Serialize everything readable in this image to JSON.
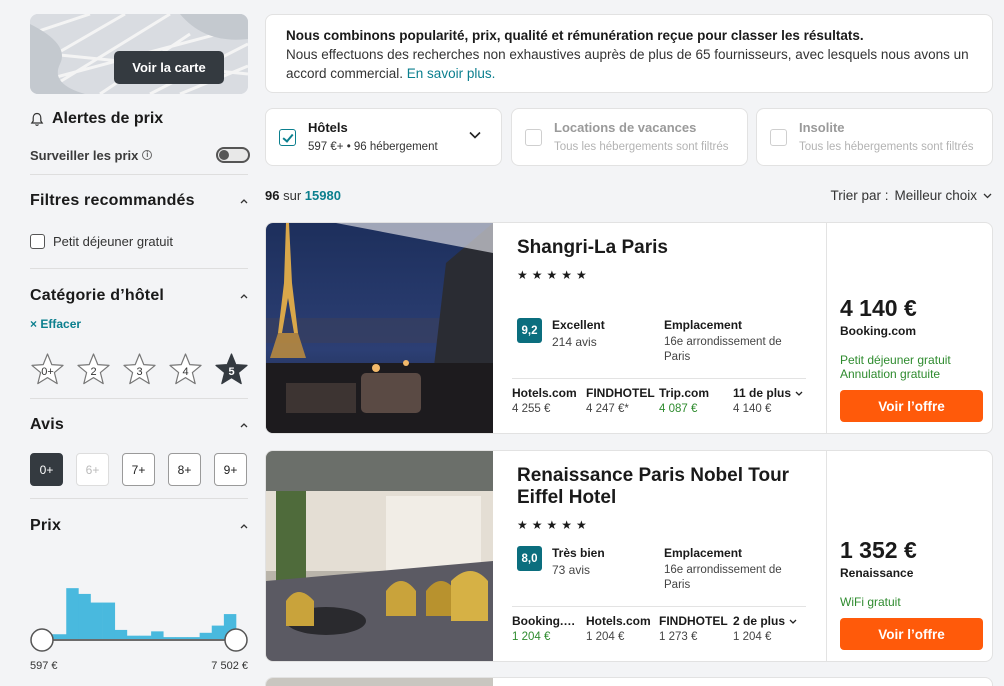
{
  "sidebar": {
    "map_button": "Voir la carte",
    "price_alerts": {
      "title": "Alertes de prix",
      "watch_label": "Surveiller les prix",
      "watch_on": false
    },
    "recommended": {
      "title": "Filtres recommandés",
      "options": [
        {
          "label": "Petit déjeuner gratuit",
          "checked": false
        }
      ]
    },
    "hotel_category": {
      "title": "Catégorie d’hôtel",
      "clear": "Effacer",
      "stars": [
        "0+",
        "2",
        "3",
        "4",
        "5"
      ],
      "selected": "5"
    },
    "reviews": {
      "title": "Avis",
      "options": [
        "0+",
        "6+",
        "7+",
        "8+",
        "9+"
      ],
      "selected": "0+",
      "disabled": [
        "6+"
      ]
    },
    "price": {
      "title": "Prix",
      "min": "597 €",
      "max": "7 502 €",
      "histogram_levels": [
        0.08,
        0.08,
        0.72,
        0.64,
        0.52,
        0.52,
        0.14,
        0.06,
        0.06,
        0.12,
        0.04,
        0.04,
        0.04,
        0.1,
        0.2,
        0.36
      ],
      "bar_color": "#49b9de"
    }
  },
  "info_box": {
    "line1": "Nous combinons popularité, prix, qualité et rémunération reçue pour classer les résultats.",
    "line2": "Nous effectuons des recherches non exhaustives auprès de plus de 65 fournisseurs, avec lesquels nous avons un accord commercial.",
    "link": "En savoir plus."
  },
  "types": [
    {
      "title": "Hôtels",
      "sub": "597 €+ • 96 hébergement",
      "checked": true,
      "muted": false
    },
    {
      "title": "Locations de vacances",
      "sub": "Tous les hébergements sont filtrés",
      "checked": false,
      "muted": true
    },
    {
      "title": "Insolite",
      "sub": "Tous les hébergements sont filtrés",
      "checked": false,
      "muted": true
    }
  ],
  "results": {
    "shown": "96",
    "of_label": "sur",
    "total": "15980",
    "sort_label": "Trier par :",
    "sort_value": "Meilleur choix"
  },
  "hotels": [
    {
      "name": "Shangri-La Paris",
      "stars": "★★★★★",
      "score": "9,2",
      "score_word": "Excellent",
      "reviews": "214 avis",
      "location_title": "Emplacement",
      "location": "16e arrondissement de Paris",
      "providers": [
        {
          "name": "Hotels.com",
          "price": "4 255 €",
          "green": false
        },
        {
          "name": "FINDHOTEL",
          "price": "4 247 €*",
          "green": false
        },
        {
          "name": "Trip.com",
          "price": "4 087 €",
          "green": true
        }
      ],
      "more": {
        "label": "11 de plus",
        "price": "4 140 €"
      },
      "price": "4 140 €",
      "price_provider": "Booking.com",
      "perks": [
        "Petit déjeuner gratuit",
        "Annulation gratuite"
      ],
      "cta": "Voir l’offre"
    },
    {
      "name": "Renaissance Paris Nobel Tour Eiffel Hotel",
      "stars": "★★★★★",
      "score": "8,0",
      "score_word": "Très bien",
      "reviews": "73 avis",
      "location_title": "Emplacement",
      "location": "16e arrondissement de Paris",
      "providers": [
        {
          "name": "Booking.com",
          "price": "1 204 €",
          "green": true
        },
        {
          "name": "Hotels.com",
          "price": "1 204 €",
          "green": false
        },
        {
          "name": "FINDHOTEL",
          "price": "1 273 €",
          "green": false
        }
      ],
      "more": {
        "label": "2 de plus",
        "price": "1 204 €"
      },
      "price": "1 352 €",
      "price_provider": "Renaissance",
      "perks": [
        "WiFi gratuit"
      ],
      "cta": "Voir l’offre"
    }
  ],
  "colors": {
    "accent": "#0b7f8e",
    "cta": "#ff5a0a",
    "badge": "#0b6e7e",
    "green_text": "#2e8b2e"
  }
}
